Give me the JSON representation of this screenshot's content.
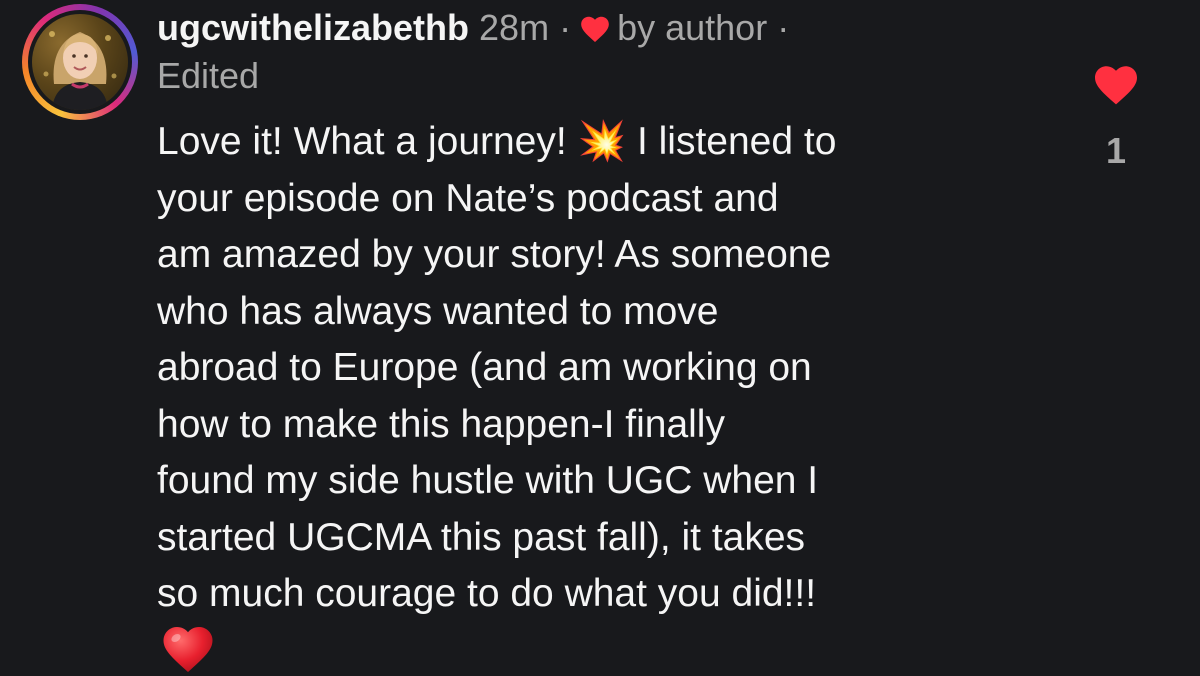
{
  "comment": {
    "author": {
      "username": "ugcwithelizabethb",
      "avatar": "profile-photo"
    },
    "timestamp": "28m",
    "separator": "·",
    "liked_by_author_label": "by author",
    "edited_label": "Edited",
    "body": "Love it! What a journey! 💥 I listened to\nyour episode on Nate’s podcast and\nam amazed by your story! As someone\nwho has always wanted to move\nabroad to Europe (and am working on\nhow to make this happen-I finally\nfound my side hustle with UGC when I\nstarted UGCMA this past fall), it takes\nso much courage to do what you did!!!",
    "trailing_emoji": "red-heart-emoji",
    "like_count": "1",
    "liked": true
  },
  "colors": {
    "background": "#18191c",
    "text": "#f5f5f5",
    "muted": "#a8a8a8",
    "heart": "#ff3040"
  },
  "icons": {
    "like": "heart-icon",
    "author_liked": "heart-icon"
  }
}
